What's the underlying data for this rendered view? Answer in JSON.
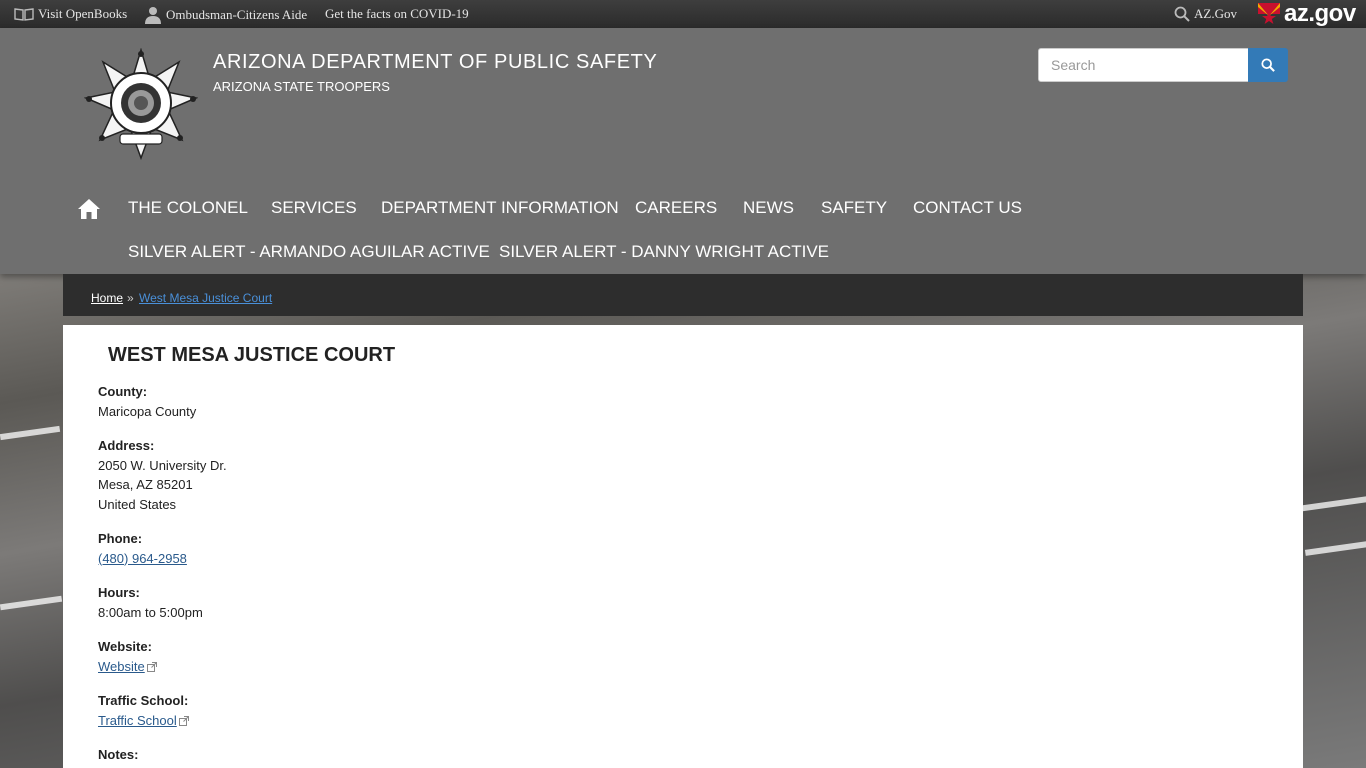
{
  "topbar": {
    "openbooks": "Visit OpenBooks",
    "ombudsman": "Ombudsman-Citizens Aide",
    "covid": "Get the facts on COVID-19",
    "azgov": "AZ.Gov",
    "azgov_logo": "az.gov"
  },
  "header": {
    "title": "ARIZONA DEPARTMENT OF PUBLIC SAFETY",
    "subtitle": "ARIZONA STATE TROOPERS",
    "search_placeholder": "Search"
  },
  "nav": {
    "items": [
      "THE COLONEL",
      "SERVICES",
      "DEPARTMENT INFORMATION",
      "CAREERS",
      "NEWS",
      "SAFETY",
      "CONTACT US",
      "SILVER ALERT - ARMANDO AGUILAR ACTIVE",
      "SILVER ALERT - DANNY WRIGHT ACTIVE"
    ]
  },
  "breadcrumb": {
    "home": "Home",
    "separator": "»",
    "current": "West Mesa Justice Court"
  },
  "page": {
    "title": "WEST MESA JUSTICE COURT",
    "county_label": "County:",
    "county": "Maricopa County",
    "address_label": "Address:",
    "address_line1": "2050 W. University Dr.",
    "address_line2": "Mesa, AZ 85201",
    "address_line3": "United States",
    "phone_label": "Phone:",
    "phone": "(480) 964-2958",
    "hours_label": "Hours:",
    "hours": "8:00am to 5:00pm",
    "website_label": "Website:",
    "website": "Website",
    "traffic_label": "Traffic School:",
    "traffic": "Traffic School",
    "notes_label": "Notes:"
  },
  "colors": {
    "header_bg": "#6f6f6f",
    "topbar_bg": "#333333",
    "breadcrumb_bg": "#2d2d2d",
    "search_button": "#337ab7",
    "link": "#2a5a8c",
    "breadcrumb_current": "#4a90d9"
  },
  "icons": [
    "book-icon",
    "person-icon",
    "search-icon",
    "arizona-flag-icon",
    "home-icon",
    "star-badge-icon",
    "external-link-icon"
  ]
}
